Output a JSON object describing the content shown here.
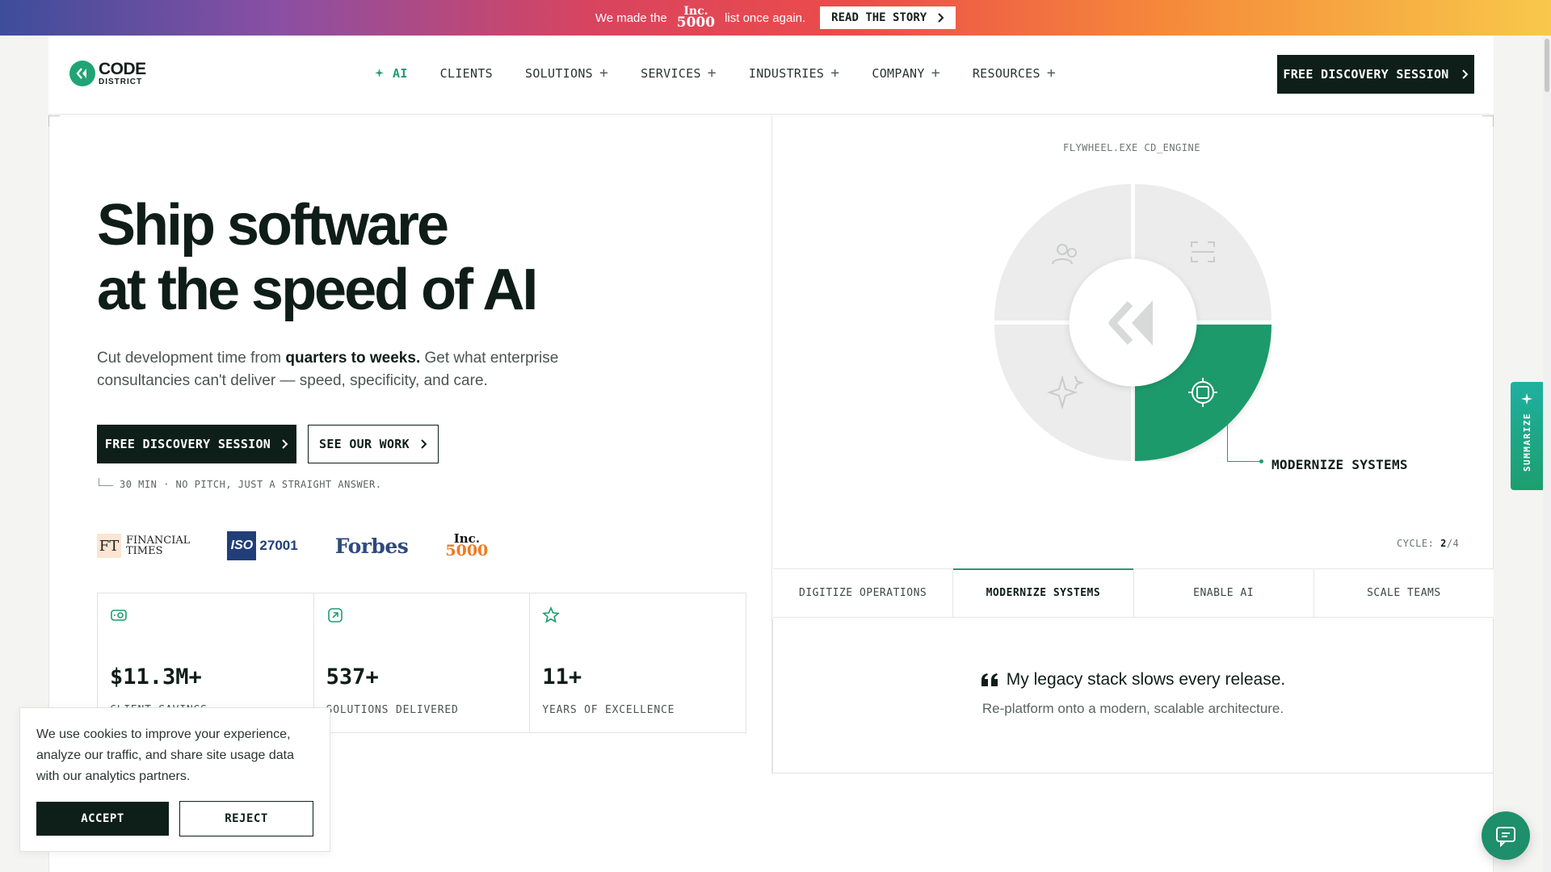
{
  "announcement": {
    "text_before": "We made the",
    "inc_top": "Inc.",
    "inc_bottom": "5000",
    "text_after": "list once again.",
    "button_label": "READ THE STORY"
  },
  "header": {
    "logo_line1": "CODE",
    "logo_line2": "DISTRICT",
    "nav": [
      {
        "label": "AI"
      },
      {
        "label": "CLIENTS"
      },
      {
        "label": "SOLUTIONS"
      },
      {
        "label": "SERVICES"
      },
      {
        "label": "INDUSTRIES"
      },
      {
        "label": "COMPANY"
      },
      {
        "label": "RESOURCES"
      }
    ],
    "cta_label": "FREE DISCOVERY SESSION"
  },
  "hero": {
    "title_line1": "Ship software",
    "title_line2": "at the speed of AI",
    "subtitle_start": "Cut development time from ",
    "subtitle_bold": "quarters to weeks.",
    "subtitle_end": " Get what enterprise consultancies can't deliver — speed, specificity, and care.",
    "primary_button": "FREE DISCOVERY SESSION",
    "secondary_button": "SEE OUR WORK",
    "fine_print": "30 MIN · NO PITCH, JUST A STRAIGHT ANSWER.",
    "press": {
      "ft_mark": "FT",
      "ft_line1": "FINANCIAL",
      "ft_line2": "TIMES",
      "iso_mark": "ISO",
      "iso_num": "27001",
      "forbes": "Forbes",
      "inc_top": "Inc.",
      "inc_bottom": "5000"
    },
    "stats": [
      {
        "value": "$11.3M+",
        "label": "CLIENT SAVINGS"
      },
      {
        "value": "537+",
        "label": "SOLUTIONS DELIVERED"
      },
      {
        "value": "11+",
        "label": "YEARS OF EXCELLENCE"
      }
    ]
  },
  "flywheel": {
    "label": "FLYWHEEL.EXE CD_ENGINE",
    "callout": "MODERNIZE SYSTEMS",
    "cycle_label": "CYCLE:",
    "cycle_current": "2",
    "cycle_total": "/4",
    "tabs": [
      {
        "label": "DIGITIZE OPERATIONS"
      },
      {
        "label": "MODERNIZE SYSTEMS"
      },
      {
        "label": "ENABLE AI"
      },
      {
        "label": "SCALE TEAMS"
      }
    ],
    "active_tab": 1,
    "quote": "My legacy stack slows every release.",
    "quote_sub": "Re-platform onto a modern, scalable architecture."
  },
  "summarize_label": "SUMMARIZE",
  "cookie": {
    "text": "We use cookies to improve your experience, analyze our traffic, and share site usage data with our analytics partners.",
    "accept": "ACCEPT",
    "reject": "REJECT"
  },
  "colors": {
    "brand_green": "#1f9c6e",
    "dark": "#0e1f1a"
  }
}
